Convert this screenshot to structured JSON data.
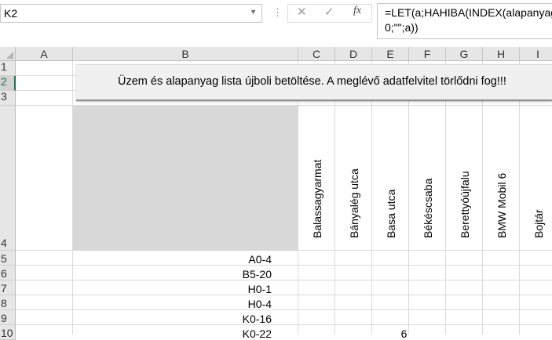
{
  "formula_bar": {
    "name_box": "K2",
    "cancel_icon": "✕",
    "enter_icon": "✓",
    "fx_label": "fx",
    "formula_line1": "=LET(a;HAHIBA(INDEX(alapanyag",
    "formula_line2": "0;\"\";a))"
  },
  "columns": [
    "A",
    "B",
    "C",
    "D",
    "E",
    "F",
    "G",
    "H",
    "I"
  ],
  "rows": [
    "1",
    "2",
    "3",
    "4",
    "5",
    "6",
    "7",
    "8",
    "9",
    "10"
  ],
  "selected_row": "2",
  "banner_button": {
    "label": "Üzem és alapanyag lista újboli betöltése. A meglévő adatfelvitel törlődni fog!!!"
  },
  "plant_headers": [
    "Balassagyarmat",
    "Bányalég utca",
    "Basa utca",
    "Békéscsaba",
    "Berettyóújfalu",
    "BMW Mobil 6",
    "Bojtár"
  ],
  "material_codes": [
    "A0-4",
    "B5-20",
    "H0-1",
    "H0-4",
    "K0-16",
    "K0-22"
  ],
  "cell_values": {
    "E10": "6"
  }
}
